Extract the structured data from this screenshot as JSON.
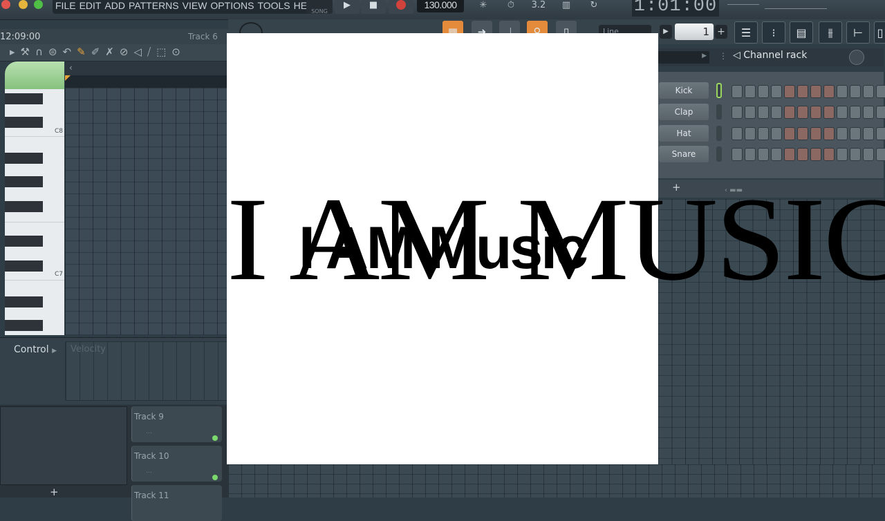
{
  "menu": {
    "items": [
      "FILE",
      "EDIT",
      "ADD",
      "PATTERNS",
      "VIEW",
      "OPTIONS",
      "TOOLS",
      "HELP"
    ],
    "song_label": "SONG"
  },
  "transport": {
    "tempo": "130.000",
    "clock": "1:01:00"
  },
  "toolbar": {
    "snap": "Line",
    "pattern_number": "1"
  },
  "piano_roll": {
    "hint_time": "12:09:00",
    "track_label": "Track 6",
    "octave_labels": [
      "C8",
      "C7"
    ],
    "control_label": "Control",
    "velocity_label": "Velocity"
  },
  "channel_rack": {
    "title": "Channel rack",
    "channels": [
      {
        "name": "Kick"
      },
      {
        "name": "Clap"
      },
      {
        "name": "Hat"
      },
      {
        "name": "Snare"
      }
    ],
    "add_label": "+"
  },
  "playlist": {
    "tracks": [
      "Track 9",
      "Track 10",
      "Track 11"
    ],
    "add_label": "+"
  },
  "artwork": {
    "serif_text": "I AM MUSIC",
    "sans_text": "I AM Music"
  },
  "colors": {
    "background": "#2f3d47",
    "artwork_bg": "#ffffff",
    "accent_green": "#86c27e",
    "step_red": "#8c6863"
  }
}
